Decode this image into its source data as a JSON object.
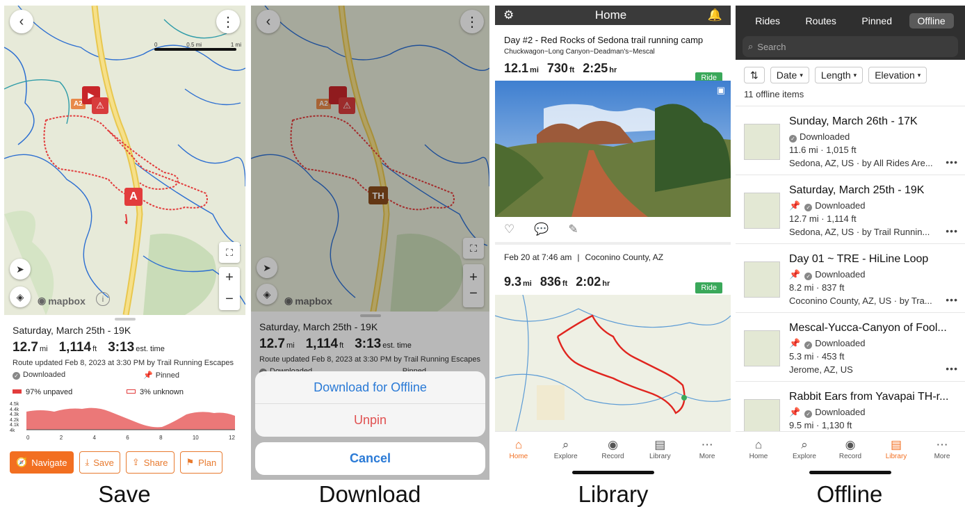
{
  "captions": [
    "Save",
    "Download",
    "Library",
    "Offline"
  ],
  "save": {
    "scale_labels": [
      "0",
      "0.5 mi",
      "1 mi"
    ],
    "markers": {
      "segment": "A2",
      "start": "A"
    },
    "mapbox": "mapbox",
    "route_title": "Saturday, March 25th - 19K",
    "distance": "12.7",
    "distance_unit": "mi",
    "elevation": "1,114",
    "elevation_unit": "ft",
    "time": "3:13",
    "time_unit": "est. time",
    "updated": "Route updated Feb 8, 2023 at 3:30 PM by Trail Running Escapes",
    "downloaded": "Downloaded",
    "pinned": "Pinned",
    "unpaved": "97% unpaved",
    "unknown": "3% unknown",
    "chart_yticks": [
      "4.5k",
      "4.4k",
      "4.3k",
      "4.2k",
      "4.1k",
      "4k"
    ],
    "chart_xticks": [
      "0",
      "2",
      "4",
      "6",
      "8",
      "10",
      "12"
    ],
    "buttons": {
      "navigate": "Navigate",
      "save": "Save",
      "share": "Share",
      "plan": "Plan"
    }
  },
  "download": {
    "marker_th": "TH",
    "route_title": "Saturday, March 25th - 19K",
    "distance": "12.7",
    "distance_unit": "mi",
    "elevation": "1,114",
    "elevation_unit": "ft",
    "time": "3:13",
    "time_unit": "est. time",
    "updated": "Route updated Feb 8, 2023 at 3:30 PM by Trail Running Escapes",
    "downloaded": "Downloaded",
    "pinned": "Pinned",
    "option_download": "Download for Offline",
    "option_unpin": "Unpin",
    "cancel": "Cancel"
  },
  "library": {
    "header": "Home",
    "card1": {
      "title": "Day #2 - Red Rocks of Sedona trail running camp",
      "subtitle": "Chuckwagon~Long Canyon~Deadman's~Mescal",
      "distance": "12.1",
      "distance_unit": "mi",
      "elevation": "730",
      "elevation_unit": "ft",
      "time": "2:25",
      "time_unit": "hr",
      "tag": "Ride"
    },
    "card2": {
      "meta": "Feb 20 at 7:46 am",
      "location": "Coconino County, AZ",
      "distance": "9.3",
      "distance_unit": "mi",
      "elevation": "836",
      "elevation_unit": "ft",
      "time": "2:02",
      "time_unit": "hr",
      "tag": "Ride"
    },
    "tabs": [
      "Home",
      "Explore",
      "Record",
      "Library",
      "More"
    ],
    "active_tab": "Home"
  },
  "offline": {
    "segments": [
      "Rides",
      "Routes",
      "Pinned",
      "Offline"
    ],
    "active_segment": "Offline",
    "search_placeholder": "Search",
    "filters": [
      "Date",
      "Length",
      "Elevation"
    ],
    "count": "11 offline items",
    "items": [
      {
        "title": "Sunday, March 26th - 17K",
        "status": "Downloaded",
        "stats": "11.6 mi · 1,015 ft",
        "location": "Sedona, AZ, US · by All Rides Are..."
      },
      {
        "title": "Saturday, March 25th - 19K",
        "status": "Downloaded",
        "stats": "12.7 mi · 1,114 ft",
        "location": "Sedona, AZ, US · by Trail Runnin..."
      },
      {
        "title": "Day 01 ~ TRE - HiLine Loop",
        "status": "Downloaded",
        "stats": "8.2 mi · 837 ft",
        "location": "Coconino County, AZ, US · by Tra..."
      },
      {
        "title": "Mescal-Yucca-Canyon of Fool...",
        "status": "Downloaded",
        "stats": "5.3 mi · 453 ft",
        "location": "Jerome, AZ, US"
      },
      {
        "title": "Rabbit Ears from Yavapai TH-r...",
        "status": "Downloaded",
        "stats": "9.5 mi · 1,130 ft",
        "location": ""
      }
    ],
    "tabs": [
      "Home",
      "Explore",
      "Record",
      "Library",
      "More"
    ],
    "active_tab": "Library"
  },
  "colors": {
    "accent": "#f26f21",
    "route": "#e23c3c",
    "ride_tag": "#3aa85a",
    "trail_blue": "#2d6fd1"
  }
}
